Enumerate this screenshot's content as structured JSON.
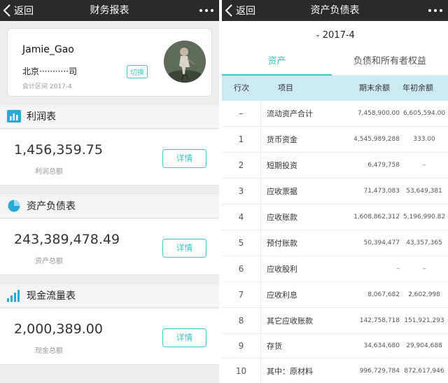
{
  "left_screen": {
    "nav": {
      "back_label": "返回",
      "title": "财务报表"
    },
    "profile": {
      "username": "Jamie_Gao",
      "company": "北京···········司",
      "switch_label": "切换",
      "period": "会计区间 2017-4"
    },
    "sections": [
      {
        "icon": "bar-chart-icon",
        "title": "利润表",
        "amount": "1,456,359.75",
        "amount_label": "利润总额",
        "detail_label": "详情"
      },
      {
        "icon": "pie-chart-icon",
        "title": "资产负债表",
        "amount": "243,389,478.49",
        "amount_label": "资产总额",
        "detail_label": "详情"
      },
      {
        "icon": "signal-bars-icon",
        "title": "现金流量表",
        "amount": "2,000,389.00",
        "amount_label": "现金总额",
        "detail_label": "详情"
      }
    ]
  },
  "right_screen": {
    "nav": {
      "back_label": "返回",
      "title": "资产负债表"
    },
    "period": "2017-4",
    "tabs": [
      {
        "label": "资产",
        "active": true
      },
      {
        "label": "负债和所有者权益",
        "active": false
      }
    ],
    "table": {
      "columns": [
        "行次",
        "项目",
        "期末余额",
        "年初余额"
      ],
      "rows": [
        {
          "no": "–",
          "name": "流动资产合计",
          "end": "7,458,900.00",
          "begin": "6,605,594.00"
        },
        {
          "no": "1",
          "name": "货币资金",
          "end": "4,545,989,288",
          "begin": "333.00"
        },
        {
          "no": "2",
          "name": "短期投资",
          "end": "6,479,758",
          "begin": "–"
        },
        {
          "no": "3",
          "name": "应收票据",
          "end": "71,473,083",
          "begin": "53,649,381"
        },
        {
          "no": "4",
          "name": "应收账款",
          "end": "1,608,862,312",
          "begin": "5,196,990.82"
        },
        {
          "no": "5",
          "name": "预付账款",
          "end": "50,394,477",
          "begin": "43,357,365"
        },
        {
          "no": "6",
          "name": "应收股利",
          "end": "–",
          "begin": "–"
        },
        {
          "no": "7",
          "name": "应收利息",
          "end": "8,067,682",
          "begin": "2,602,998"
        },
        {
          "no": "8",
          "name": "其它应收账款",
          "end": "142,758,718",
          "begin": "151,921,293"
        },
        {
          "no": "9",
          "name": "存货",
          "end": "34,634,680",
          "begin": "29,904,688"
        },
        {
          "no": "10",
          "name": "其中：原材料",
          "end": "996,729,784",
          "begin": "872,617,946"
        }
      ]
    }
  },
  "colors": {
    "accent": "#3ec5c5",
    "nav_bg": "#2b2b2b",
    "table_header_bg": "#cceaf4"
  }
}
